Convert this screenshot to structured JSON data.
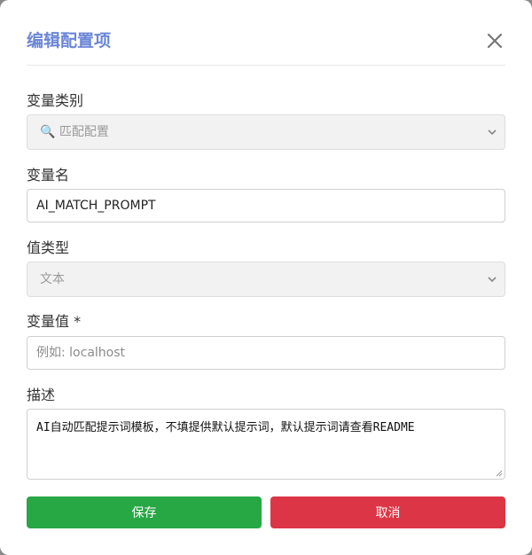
{
  "dialog": {
    "title": "编辑配置项"
  },
  "fields": {
    "category": {
      "label": "变量类别",
      "icon": "search-icon",
      "value": "🔍 匹配配置",
      "disabled": true
    },
    "name": {
      "label": "变量名",
      "value": "AI_MATCH_PROMPT"
    },
    "value_type": {
      "label": "值类型",
      "value": "文本",
      "disabled": true
    },
    "value": {
      "label": "变量值 *",
      "placeholder": "例如: localhost",
      "value": ""
    },
    "description": {
      "label": "描述",
      "value": "AI自动匹配提示词模板，不填提供默认提示词，默认提示词请查看README"
    }
  },
  "actions": {
    "save_label": "保存",
    "cancel_label": "取消"
  },
  "colors": {
    "title": "#6b86d6",
    "save": "#28a745",
    "cancel": "#dc3545"
  }
}
